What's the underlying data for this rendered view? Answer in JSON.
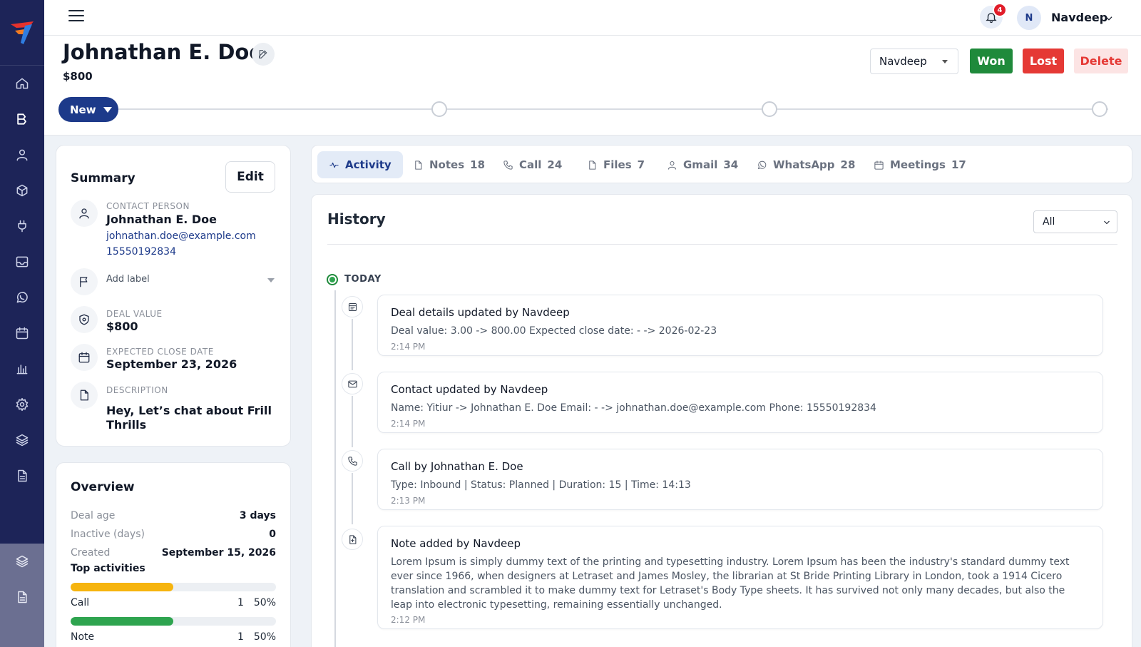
{
  "topbar": {
    "notifications_count": "4",
    "avatar_initial": "N",
    "username": "Navdeep"
  },
  "deal": {
    "title": "Johnathan E. Doe",
    "amount": "$800",
    "owner": "Navdeep",
    "won_label": "Won",
    "lost_label": "Lost",
    "delete_label": "Delete",
    "stage": "New"
  },
  "colors": {
    "sidebar": "#1d2458",
    "primary": "#1d3a8a",
    "won": "#1f8a3b",
    "lost": "#e53935"
  },
  "summary": {
    "title": "Summary",
    "edit_label": "Edit",
    "contact_label": "CONTACT PERSON",
    "contact_name": "Johnathan E. Doe",
    "contact_email": "johnathan.doe@example.com",
    "contact_phone": "15550192834",
    "add_label": "Add label",
    "deal_value_label": "DEAL VALUE",
    "deal_value": "$800",
    "close_date_label": "EXPECTED CLOSE DATE",
    "close_date": "September 23, 2026",
    "description_label": "DESCRIPTION",
    "description": "Hey, Let’s chat about Frill Thrills"
  },
  "overview": {
    "title": "Overview",
    "rows": [
      {
        "key": "Deal age",
        "value": "3 days"
      },
      {
        "key": "Inactive (days)",
        "value": "0"
      },
      {
        "key": "Created",
        "value": "September 15, 2026"
      }
    ],
    "top_activities_label": "Top activities",
    "activities": [
      {
        "name": "Call",
        "count": "1",
        "percent": "50%",
        "fraction": 0.5,
        "color": "#f6b40e"
      },
      {
        "name": "Note",
        "count": "1",
        "percent": "50%",
        "fraction": 0.5,
        "color": "#2ea44f"
      }
    ]
  },
  "tabs": [
    {
      "label": "Activity",
      "count": "",
      "icon": "activity-icon"
    },
    {
      "label": "Notes",
      "count": "18",
      "icon": "note-icon"
    },
    {
      "label": "Call",
      "count": "24",
      "icon": "phone-icon"
    },
    {
      "label": "Files",
      "count": "7",
      "icon": "file-icon"
    },
    {
      "label": "Gmail",
      "count": "34",
      "icon": "user-icon"
    },
    {
      "label": "WhatsApp",
      "count": "28",
      "icon": "whatsapp-icon"
    },
    {
      "label": "Meetings",
      "count": "17",
      "icon": "calendar-icon"
    }
  ],
  "history": {
    "title": "History",
    "filter_value": "All",
    "group_label": "TODAY",
    "entries": [
      {
        "title": "Deal details updated by Navdeep",
        "body": "Deal value: 3.00 -> 800.00 Expected close date: - -> 2026-02-23",
        "time": "2:14 PM",
        "icon": "deal-icon"
      },
      {
        "title": "Contact updated by Navdeep",
        "body": "Name: Yitiur -> Johnathan E. Doe Email: - -> johnathan.doe@example.com Phone: 15550192834",
        "time": "2:14 PM",
        "icon": "mail-icon"
      },
      {
        "title": "Call by Johnathan E. Doe",
        "body": "Type: Inbound | Status: Planned | Duration: 15 | Time: 14:13",
        "time": "2:13 PM",
        "icon": "phone-icon"
      },
      {
        "title": "Note added by Navdeep",
        "body": "Lorem Ipsum is simply dummy text of the printing and typesetting industry. Lorem Ipsum has been the industry's standard dummy text ever since 1966, when designers at Letraset and James Mosley, the librarian at St Bride Printing Library in London, took a 1914 Cicero translation and scrambled it to make dummy text for Letraset's Body Type sheets. It has survived not only many decades, but also the leap into electronic typesetting, remaining essentially unchanged.",
        "time": "2:12 PM",
        "icon": "note-add-icon"
      }
    ]
  }
}
